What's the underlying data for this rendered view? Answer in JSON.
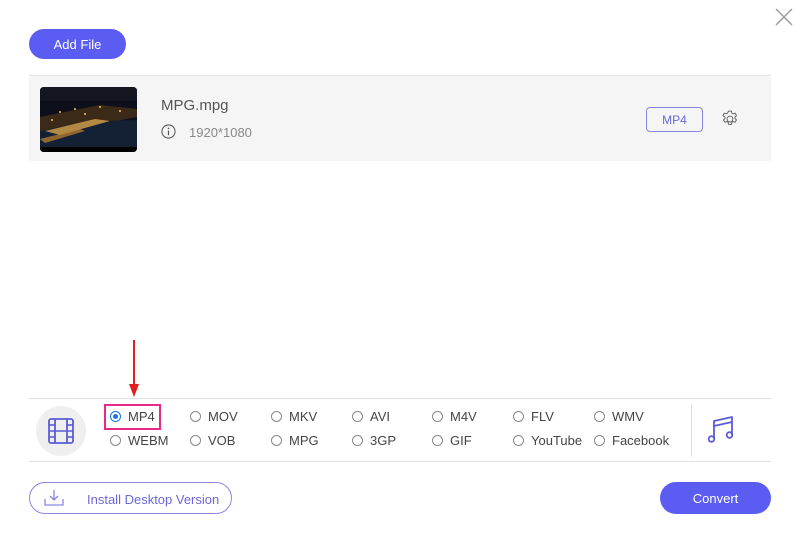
{
  "header": {
    "add_file_label": "Add File",
    "close_icon": "close-icon"
  },
  "file": {
    "name": "MPG.mpg",
    "resolution": "1920*1080",
    "output_format": "MP4",
    "info_icon": "info-icon",
    "settings_icon": "gear-icon"
  },
  "formats": {
    "selected": "MP4",
    "video_tab_icon": "film-icon",
    "audio_tab_icon": "music-note-icon",
    "options": [
      {
        "label": "MP4",
        "checked": true
      },
      {
        "label": "MOV",
        "checked": false
      },
      {
        "label": "MKV",
        "checked": false
      },
      {
        "label": "AVI",
        "checked": false
      },
      {
        "label": "M4V",
        "checked": false
      },
      {
        "label": "FLV",
        "checked": false
      },
      {
        "label": "WMV",
        "checked": false
      },
      {
        "label": "WEBM",
        "checked": false
      },
      {
        "label": "VOB",
        "checked": false
      },
      {
        "label": "MPG",
        "checked": false
      },
      {
        "label": "3GP",
        "checked": false
      },
      {
        "label": "GIF",
        "checked": false
      },
      {
        "label": "YouTube",
        "checked": false
      },
      {
        "label": "Facebook",
        "checked": false
      }
    ]
  },
  "footer": {
    "install_label": "Install Desktop Version",
    "convert_label": "Convert"
  },
  "colors": {
    "accent": "#5b5cf1",
    "highlight": "#e52a8a",
    "annotation_arrow": "#e0201f"
  }
}
